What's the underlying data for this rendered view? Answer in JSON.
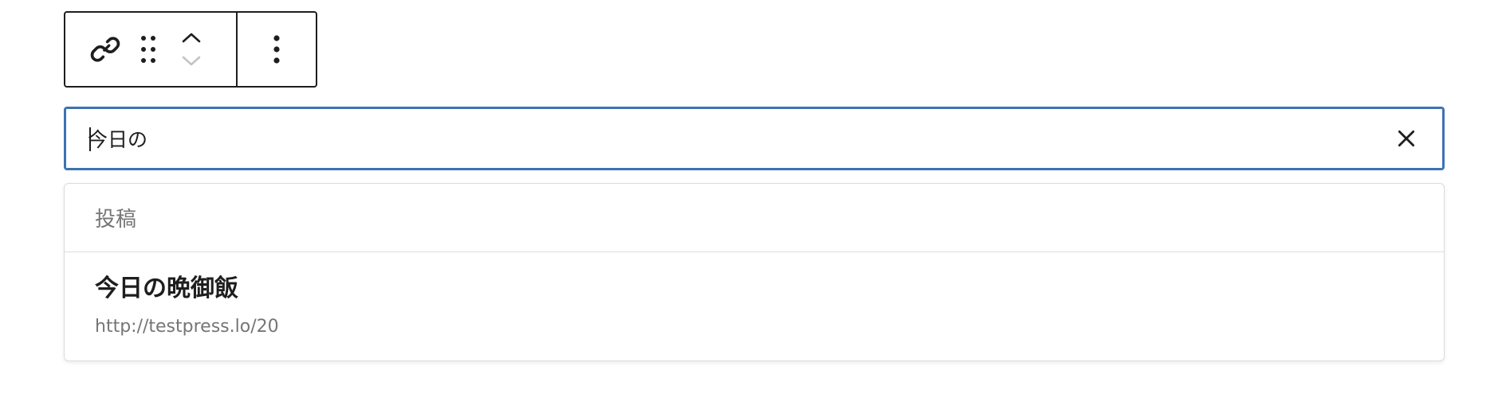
{
  "toolbar": {
    "icons": {
      "link": "link-icon",
      "drag": "drag-handle-icon",
      "move_up": "chevron-up-icon",
      "move_down": "chevron-down-icon",
      "more": "more-vertical-icon"
    }
  },
  "search": {
    "value": "今日の",
    "clear_icon": "close-icon"
  },
  "results": {
    "group_label": "投稿",
    "items": [
      {
        "title": "今日の晩御飯",
        "url": "http://testpress.lo/20"
      }
    ]
  },
  "colors": {
    "focus_border": "#3c72b6",
    "text": "#1e1e1e",
    "muted": "#757575",
    "divider": "#dcdcde"
  }
}
